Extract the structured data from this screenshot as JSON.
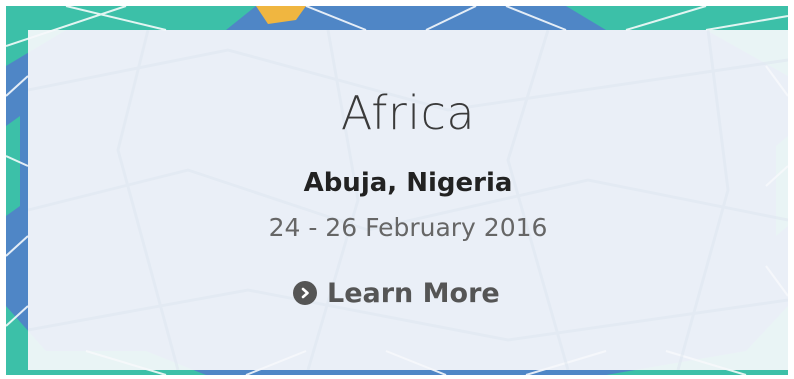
{
  "card": {
    "region": "Africa",
    "city": "Abuja, Nigeria",
    "dates": "24 - 26 February 2016",
    "link_label": "Learn More",
    "link_icon": "chevron-circle-right-icon"
  },
  "colors": {
    "map_blue": "#4f86c6",
    "map_teal": "#3cc0a8",
    "map_gold": "#f0b640",
    "card_background": "#f6f8fb",
    "title_text": "#3a3a3a",
    "city_text": "#222222",
    "dates_text": "#666666",
    "link_text": "#555555"
  }
}
